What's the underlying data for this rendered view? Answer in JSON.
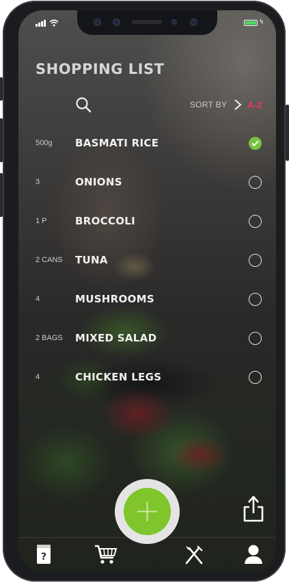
{
  "status_bar": {
    "signal_icon": "cellular-signal-icon",
    "wifi_icon": "wifi-icon",
    "battery_icon": "battery-icon",
    "battery_color": "#4cd964"
  },
  "header": {
    "title": "SHOPPING LIST"
  },
  "toolbar": {
    "search_icon": "search-icon",
    "sort_label": "SORT BY",
    "sort_value": "A-Z",
    "sort_accent": "#e5385a"
  },
  "items": [
    {
      "qty": "500g",
      "name": "BASMATI RICE",
      "checked": true
    },
    {
      "qty": "3",
      "name": "ONIONS",
      "checked": false
    },
    {
      "qty": "1 P",
      "name": "BROCCOLI",
      "checked": false
    },
    {
      "qty": "2 CANS",
      "name": "TUNA",
      "checked": false
    },
    {
      "qty": "4",
      "name": "MUSHROOMS",
      "checked": false
    },
    {
      "qty": "2 BAGS",
      "name": "MIXED SALAD",
      "checked": false
    },
    {
      "qty": "4",
      "name": "CHICKEN LEGS",
      "checked": false
    }
  ],
  "actions": {
    "add_icon": "plus-icon",
    "add_color": "#7fc52b",
    "share_icon": "share-icon"
  },
  "tab_bar": {
    "tabs": [
      "help-book-icon",
      "shopping-cart-icon",
      "fork-knife-icon",
      "user-icon"
    ]
  }
}
